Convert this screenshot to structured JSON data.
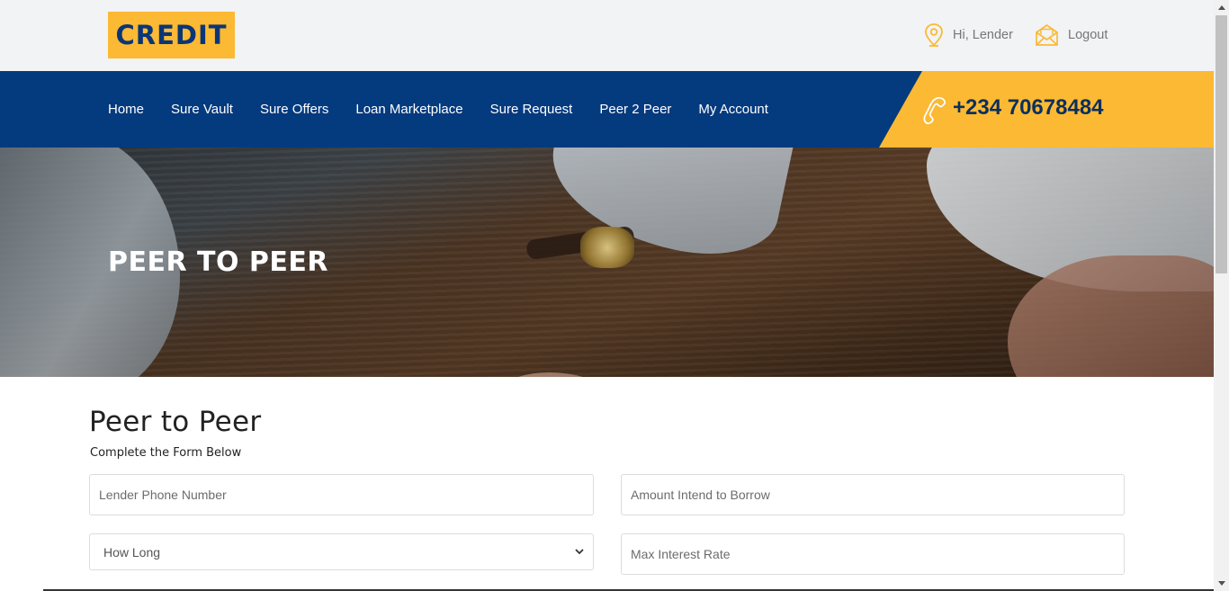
{
  "brand": {
    "logo_text": "CREDIT",
    "accent": "#fbb934",
    "primary": "#043a7e"
  },
  "header": {
    "greeting": "Hi, Lender",
    "greeting_icon": "location-pin-icon",
    "logout_label": "Logout",
    "logout_icon": "envelope-icon"
  },
  "nav": {
    "items": [
      {
        "label": "Home"
      },
      {
        "label": "Sure Vault"
      },
      {
        "label": "Sure Offers"
      },
      {
        "label": "Loan Marketplace"
      },
      {
        "label": "Sure Request"
      },
      {
        "label": "Peer 2 Peer"
      },
      {
        "label": "My Account"
      }
    ],
    "phone": "+234 70678484",
    "phone_icon": "phone-icon"
  },
  "hero": {
    "title": "PEER TO PEER"
  },
  "form": {
    "title": "Peer to Peer",
    "subtitle": "Complete the Form Below",
    "lender_phone_placeholder": "Lender Phone Number",
    "amount_placeholder": "Amount Intend to Borrow",
    "duration_selected": "How Long",
    "max_interest_placeholder": "Max Interest Rate"
  }
}
